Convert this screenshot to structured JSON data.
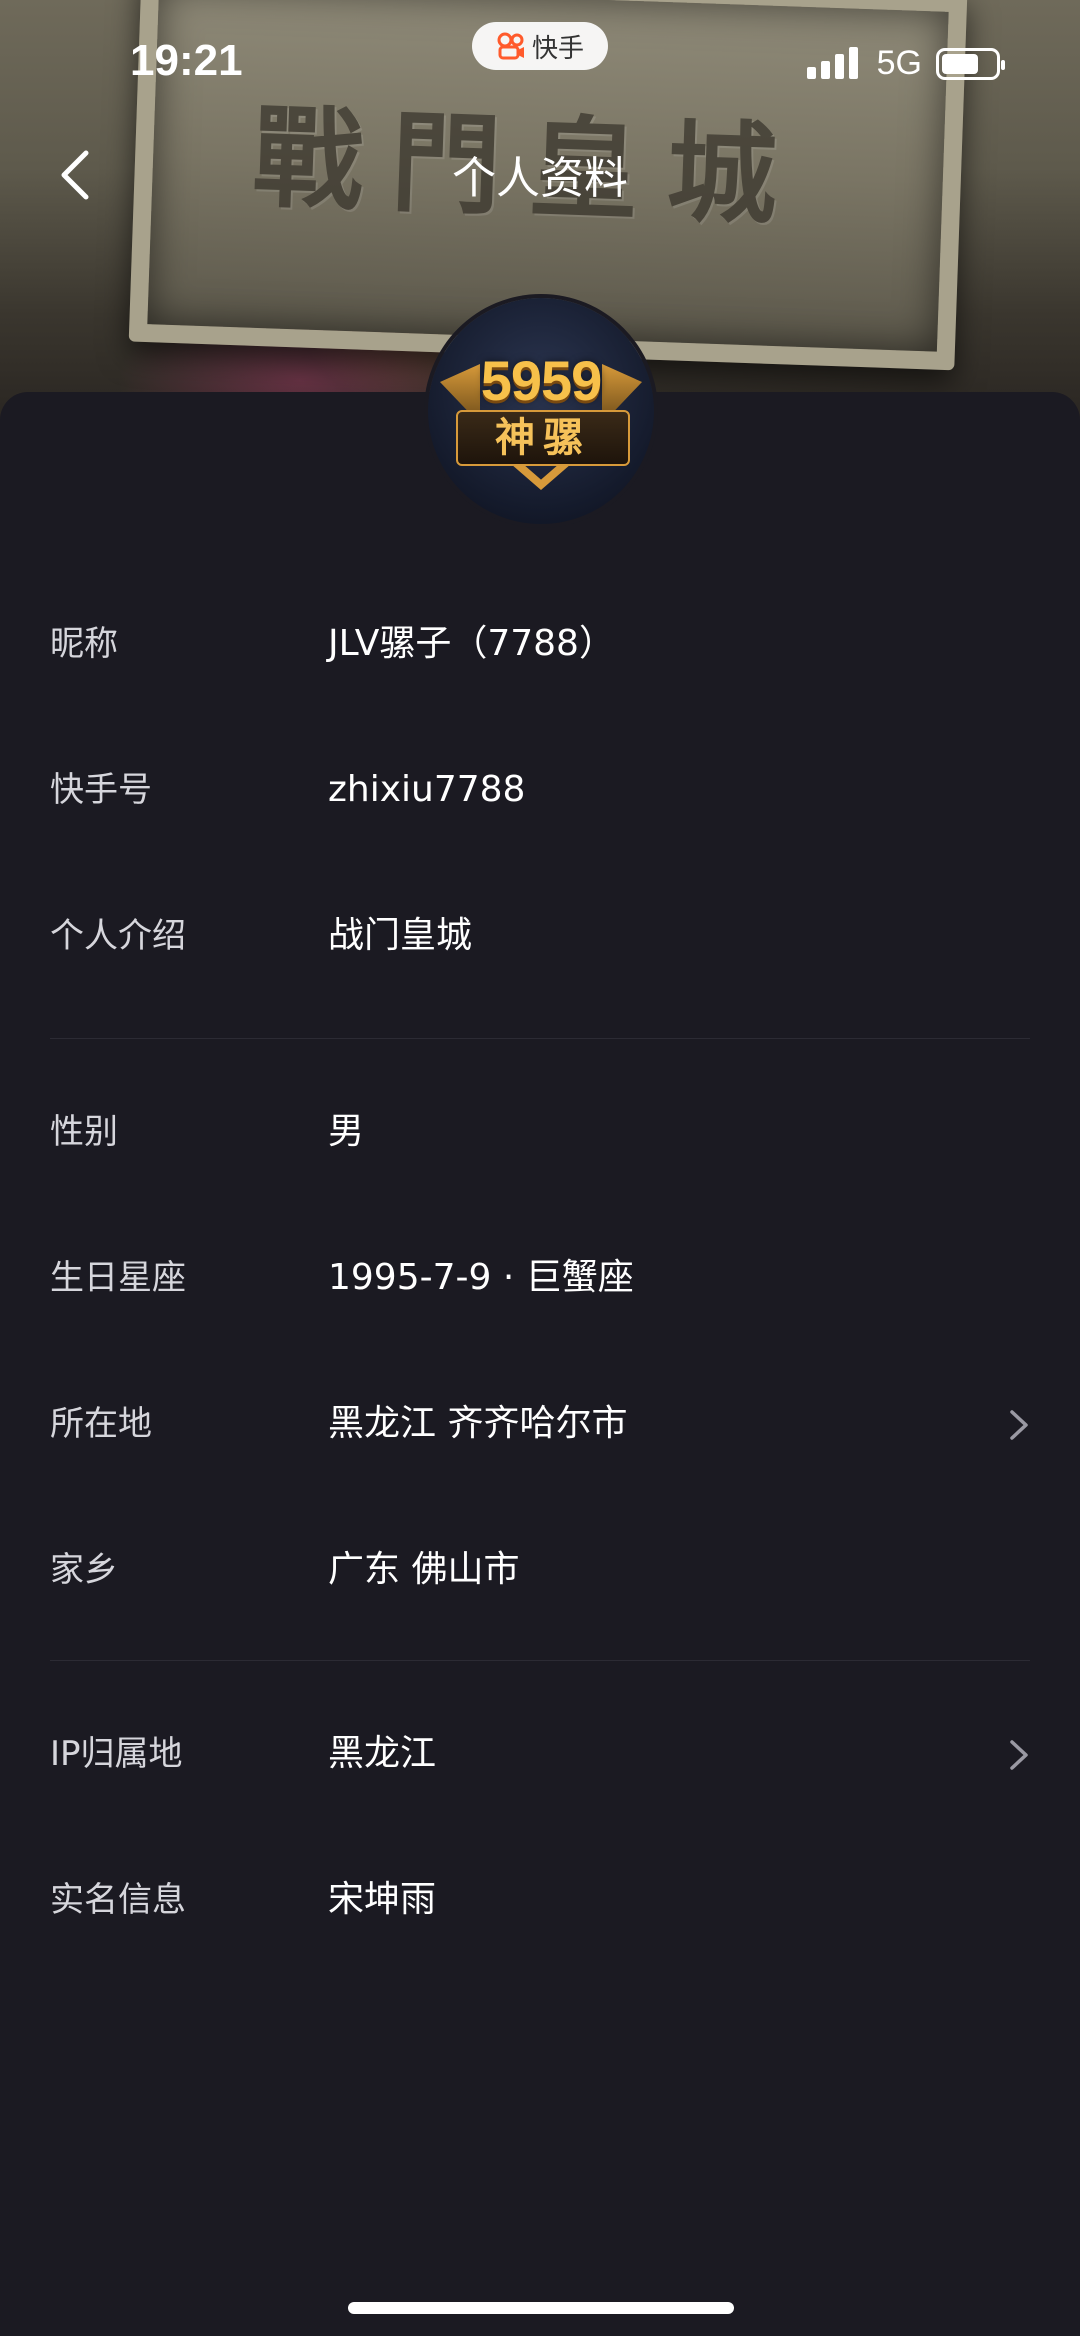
{
  "status_bar": {
    "time": "19:21",
    "app_badge": "快手",
    "network": "5G",
    "battery_level": 0.6
  },
  "header": {
    "title": "个人资料",
    "background_text": "戰門皇城"
  },
  "avatar": {
    "number": "5959",
    "name": "神骡"
  },
  "profile": {
    "nickname": {
      "label": "昵称",
      "value": "JLV骡子（7788）"
    },
    "kuaishou_id": {
      "label": "快手号",
      "value": "zhixiu7788"
    },
    "intro": {
      "label": "个人介绍",
      "value": "战门皇城"
    },
    "gender": {
      "label": "性别",
      "value": "男"
    },
    "birthday": {
      "label": "生日星座",
      "value": "1995-7-9 · 巨蟹座"
    },
    "location": {
      "label": "所在地",
      "value": "黑龙江 齐齐哈尔市"
    },
    "hometown": {
      "label": "家乡",
      "value": "广东 佛山市"
    },
    "ip_location": {
      "label": "IP归属地",
      "value": "黑龙江"
    },
    "real_name": {
      "label": "实名信息",
      "value": "宋坤雨"
    }
  },
  "icons": [
    "back-arrow-icon",
    "chevron-right-icon",
    "signal-icon",
    "battery-icon",
    "kuaishou-logo-icon"
  ]
}
